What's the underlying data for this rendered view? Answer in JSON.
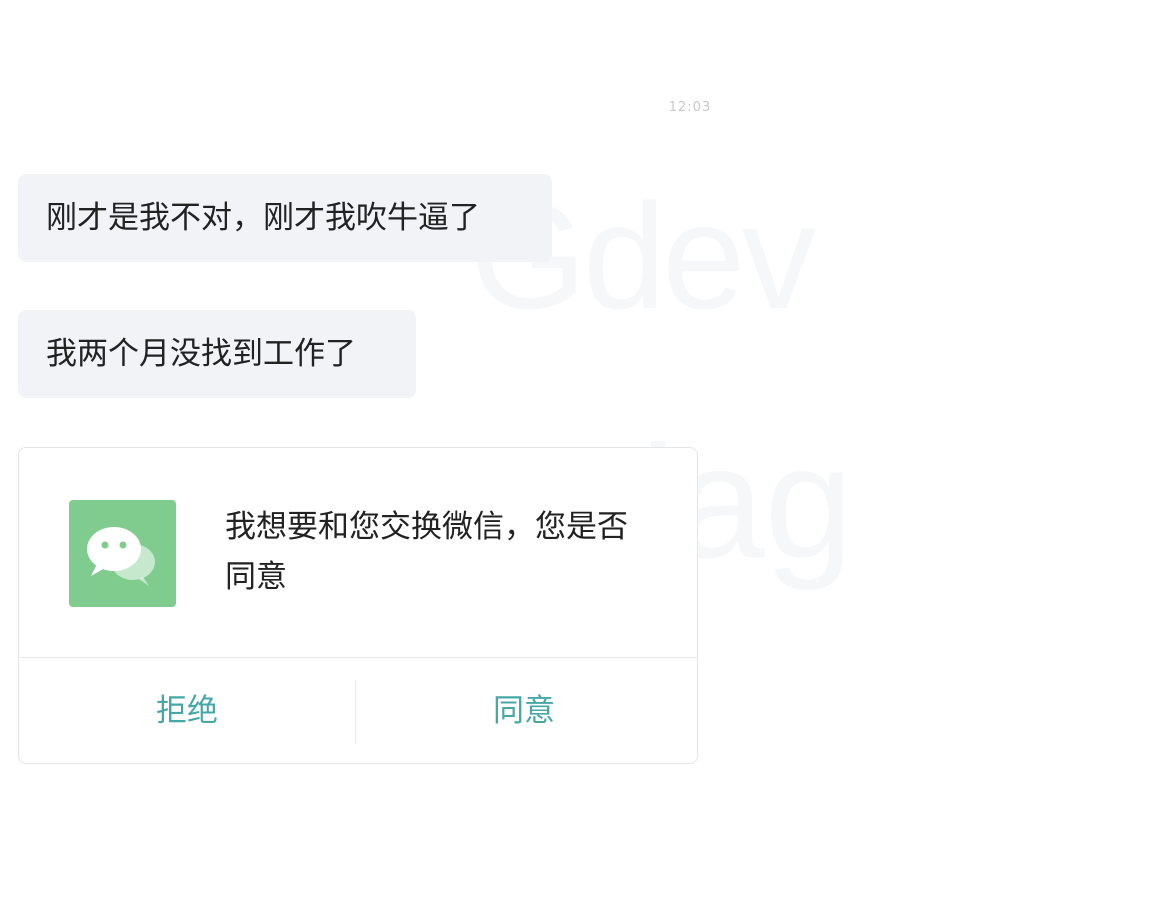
{
  "chat": {
    "timestamp": "12:03",
    "messages": [
      {
        "text": "刚才是我不对，刚才我吹牛逼了"
      },
      {
        "text": "我两个月没找到工作了"
      }
    ],
    "wechat_card": {
      "icon": "wechat-icon",
      "text": "我想要和您交换微信，您是否同意",
      "reject_label": "拒绝",
      "accept_label": "同意"
    }
  },
  "colors": {
    "bubble_bg": "#f1f3f7",
    "wechat_green": "#80cc8f",
    "action_teal": "#47a7a6"
  }
}
